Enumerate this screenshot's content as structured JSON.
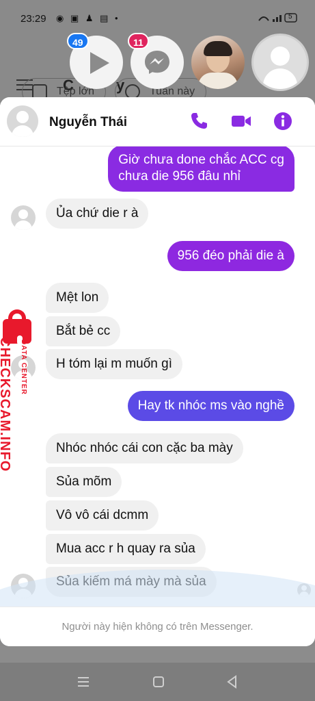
{
  "status_bar": {
    "time": "23:29",
    "notif_icons": "◉ ▣ ♟ ▤ •",
    "battery": "5"
  },
  "background_app": {
    "title_partial": "C",
    "title_partial_2": "y",
    "chips": [
      "Tệp lớn",
      "Tuần này"
    ]
  },
  "chat_heads": [
    {
      "name": "play-app",
      "badge": "49"
    },
    {
      "name": "messenger",
      "badge": "11"
    },
    {
      "name": "contact-photo",
      "badge": ""
    },
    {
      "name": "active-contact",
      "badge": ""
    }
  ],
  "header": {
    "contact_name": "Nguyễn Thái",
    "accent_color": "#8a2be2"
  },
  "messages": [
    {
      "dir": "out",
      "lines": [
        "Giờ chưa done chắc ACC cg",
        "chưa die 956 đâu nhỉ"
      ]
    },
    {
      "dir": "in",
      "text": "Ủa chứ die r à"
    },
    {
      "dir": "out",
      "text": "956 đéo phải die à"
    },
    {
      "dir": "in",
      "text": "Mệt lon"
    },
    {
      "dir": "in",
      "text": "Bắt bẻ cc"
    },
    {
      "dir": "in",
      "text": "H tóm lại m muốn gì"
    },
    {
      "dir": "out",
      "text": "Hay tk nhóc ms vào nghề"
    },
    {
      "dir": "in",
      "text": "Nhóc nhóc cái con cặc ba mày"
    },
    {
      "dir": "in",
      "text": "Sủa mõm"
    },
    {
      "dir": "in",
      "text": "Vô vô cái dcmm"
    },
    {
      "dir": "in",
      "text": "Mua acc r h quay ra sủa"
    },
    {
      "dir": "in",
      "text": "Sủa kiếm má mày mà sủa"
    }
  ],
  "footer": {
    "notice": "Người này hiện không có trên Messenger."
  },
  "watermark": {
    "main": "CHECKSCAM.INFO",
    "sub": "DATA CENTER"
  }
}
